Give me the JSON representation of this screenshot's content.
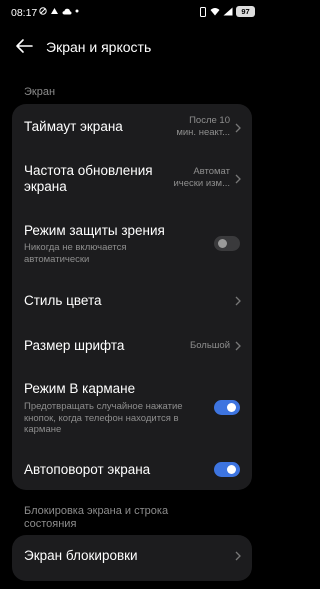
{
  "status_bar": {
    "time": "08:17",
    "battery": "97"
  },
  "header": {
    "title": "Экран и яркость"
  },
  "sections": {
    "screen_label": "Экран",
    "lock_label_line1": "Блокировка экрана и строка",
    "lock_label_line2": "состояния"
  },
  "items": {
    "timeout": {
      "title": "Таймаут экрана",
      "value_line1": "После 10",
      "value_line2": "мин. неакт..."
    },
    "refresh": {
      "title_line1": "Частота обновления",
      "title_line2": "экрана",
      "value_line1": "Автомат",
      "value_line2": "ически изм..."
    },
    "eye": {
      "title": "Режим защиты зрения",
      "sub_line1": "Никогда не включается",
      "sub_line2": "автоматически",
      "enabled": false
    },
    "color": {
      "title": "Стиль цвета"
    },
    "font": {
      "title": "Размер шрифта",
      "value": "Большой"
    },
    "pocket": {
      "title": "Режим В кармане",
      "sub_line1": "Предотвращать случайное нажатие",
      "sub_line2": "кнопок, когда телефон находится в",
      "sub_line3": "кармане",
      "enabled": true
    },
    "autorotate": {
      "title": "Автоповорот экрана",
      "enabled": true
    },
    "lockscreen": {
      "title": "Экран блокировки"
    }
  },
  "colors": {
    "background": "#000000",
    "card": "#1c1c1e",
    "accent": "#3d74e0"
  },
  "icons": [
    "back-arrow-icon",
    "chevron-right-icon",
    "mute-icon",
    "weather-icon",
    "cloud-icon",
    "dnd-icon",
    "wifi-icon",
    "signal-icon",
    "battery-icon"
  ]
}
